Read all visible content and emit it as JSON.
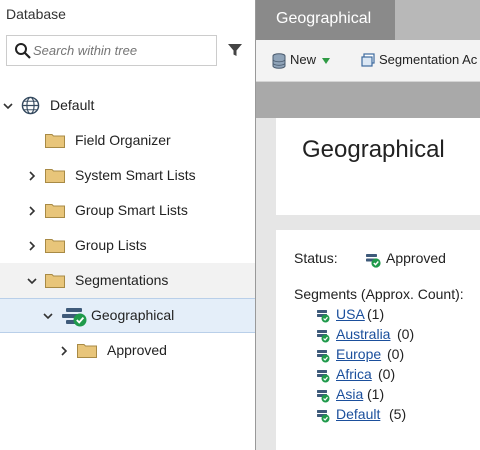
{
  "tree": {
    "title": "Database",
    "search_placeholder": "Search within tree",
    "nodes": [
      {
        "label": "Default",
        "icon": "globe-icon",
        "expanded": true
      },
      {
        "label": "Field Organizer",
        "icon": "folder-icon"
      },
      {
        "label": "System Smart Lists",
        "icon": "folder-icon"
      },
      {
        "label": "Group Smart Lists",
        "icon": "folder-icon"
      },
      {
        "label": "Group Lists",
        "icon": "folder-icon"
      },
      {
        "label": "Segmentations",
        "icon": "folder-icon",
        "expanded": true
      },
      {
        "label": "Geographical",
        "icon": "segmentation-approved-icon",
        "expanded": true,
        "selected": true
      },
      {
        "label": "Approved",
        "icon": "folder-icon"
      }
    ]
  },
  "main": {
    "tab_label": "Geographical",
    "toolbar": {
      "new_label": "New",
      "segmentation_label": "Segmentation Ac"
    },
    "title": "Geographical",
    "status_label": "Status:",
    "status_value": "Approved",
    "segments_label": "Segments (Approx. Count):",
    "segments": [
      {
        "name": "USA",
        "count": "(1)"
      },
      {
        "name": "Australia",
        "count": "(0)"
      },
      {
        "name": "Europe",
        "count": "(0)"
      },
      {
        "name": "Africa",
        "count": "(0)"
      },
      {
        "name": "Asia",
        "count": "(1)"
      },
      {
        "name": "Default",
        "count": "(5)"
      }
    ]
  },
  "colors": {
    "link": "#1b4f9c",
    "folder": "#e8c57a",
    "selected_bg": "#e4eef9",
    "tab_bg": "#8a8a8a"
  }
}
